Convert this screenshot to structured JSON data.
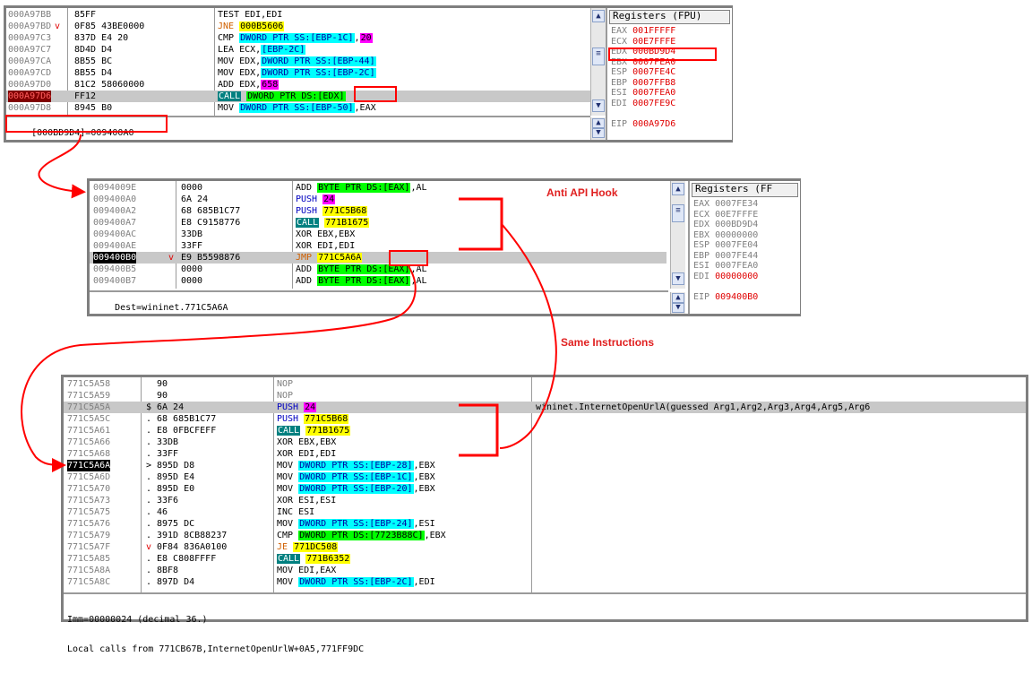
{
  "panel1": {
    "rows": [
      {
        "addr": "000A97BB",
        "mark": "",
        "bytes": "85FF",
        "instr": [
          {
            "t": "TEST EDI,EDI"
          }
        ]
      },
      {
        "addr": "000A97BD",
        "mark": "v",
        "bytes": "0F85 43BE0000",
        "instr": [
          {
            "t": "JNE",
            "c": "kw-orange"
          },
          {
            "t": " "
          },
          {
            "t": "000B5606",
            "h": "yellow"
          }
        ]
      },
      {
        "addr": "000A97C3",
        "mark": "",
        "bytes": "837D E4 20",
        "instr": [
          {
            "t": "CMP "
          },
          {
            "t": "DWORD PTR SS:[EBP-1C]",
            "h": "cyan"
          },
          {
            "t": ","
          },
          {
            "t": "20",
            "h": "magenta"
          }
        ]
      },
      {
        "addr": "000A97C7",
        "mark": "",
        "bytes": "8D4D D4",
        "instr": [
          {
            "t": "LEA ECX,"
          },
          {
            "t": "[EBP-2C]",
            "h": "cyan"
          }
        ]
      },
      {
        "addr": "000A97CA",
        "mark": "",
        "bytes": "8B55 BC",
        "instr": [
          {
            "t": "MOV EDX,"
          },
          {
            "t": "DWORD PTR SS:[EBP-44]",
            "h": "cyan"
          }
        ]
      },
      {
        "addr": "000A97CD",
        "mark": "",
        "bytes": "8B55 D4",
        "instr": [
          {
            "t": "MOV EDX,"
          },
          {
            "t": "DWORD PTR SS:[EBP-2C]",
            "h": "cyan"
          }
        ]
      },
      {
        "addr": "000A97D0",
        "mark": "",
        "bytes": "81C2 58060000",
        "instr": [
          {
            "t": "ADD EDX,"
          },
          {
            "t": "658",
            "h": "magenta"
          }
        ]
      },
      {
        "addr": "000A97D6",
        "mark": "",
        "bytes": "FF12",
        "sel": true,
        "addrStyle": "bp",
        "instr": [
          {
            "t": "CALL",
            "h": "teal"
          },
          {
            "t": " "
          },
          {
            "t": "DWORD PTR DS:[EDX]",
            "h": "green"
          }
        ]
      },
      {
        "addr": "000A97D8",
        "mark": "",
        "bytes": "8945 B0",
        "instr": [
          {
            "t": "MOV "
          },
          {
            "t": "DWORD PTR SS:[EBP-50]",
            "h": "cyan"
          },
          {
            "t": ",EAX"
          }
        ]
      }
    ],
    "info": "[000BD9D4]=009400A0",
    "regs_title": "Registers (FPU)",
    "regs": [
      {
        "n": "EAX",
        "v": "001FFFFF",
        "c": "red"
      },
      {
        "n": "ECX",
        "v": "00E7FFFE",
        "c": "red"
      },
      {
        "n": "EDX",
        "v": "000BD9D4",
        "c": "red"
      },
      {
        "n": "EBX",
        "v": "0007FEA0",
        "c": "red"
      },
      {
        "n": "ESP",
        "v": "0007FE4C",
        "c": "red"
      },
      {
        "n": "EBP",
        "v": "0007FFB8",
        "c": "red"
      },
      {
        "n": "ESI",
        "v": "0007FEA0",
        "c": "red"
      },
      {
        "n": "EDI",
        "v": "0007FE9C",
        "c": "red"
      },
      {
        "n": "",
        "v": "",
        "c": "red"
      },
      {
        "n": "EIP",
        "v": "000A97D6",
        "c": "red"
      }
    ]
  },
  "panel2": {
    "rows": [
      {
        "addr": "0094009E",
        "mark": "",
        "bytes": "0000",
        "instr": [
          {
            "t": "ADD "
          },
          {
            "t": "BYTE PTR DS:[EAX]",
            "h": "green"
          },
          {
            "t": ",AL"
          }
        ]
      },
      {
        "addr": "009400A0",
        "mark": "",
        "bytes": "6A 24",
        "instr": [
          {
            "t": "PUSH",
            "c": "kw-blue"
          },
          {
            "t": " "
          },
          {
            "t": "24",
            "h": "magenta"
          }
        ]
      },
      {
        "addr": "009400A2",
        "mark": "",
        "bytes": "68 685B1C77",
        "instr": [
          {
            "t": "PUSH",
            "c": "kw-blue"
          },
          {
            "t": " "
          },
          {
            "t": "771C5B68",
            "h": "yellow"
          }
        ]
      },
      {
        "addr": "009400A7",
        "mark": "",
        "bytes": "E8 C9158776",
        "instr": [
          {
            "t": "CALL",
            "h": "teal"
          },
          {
            "t": " "
          },
          {
            "t": "771B1675",
            "h": "yellow"
          }
        ]
      },
      {
        "addr": "009400AC",
        "mark": "",
        "bytes": "33DB",
        "instr": [
          {
            "t": "XOR EBX,EBX"
          }
        ]
      },
      {
        "addr": "009400AE",
        "mark": "",
        "bytes": "33FF",
        "instr": [
          {
            "t": "XOR EDI,EDI"
          }
        ]
      },
      {
        "addr": "009400B0",
        "mark": "v",
        "bytes": "E9 B5598876",
        "sel": true,
        "addrStyle": "cur",
        "instr": [
          {
            "t": "JMP",
            "c": "kw-orange"
          },
          {
            "t": " "
          },
          {
            "t": "771C5A6A",
            "h": "yellow"
          }
        ]
      },
      {
        "addr": "009400B5",
        "mark": "",
        "bytes": "0000",
        "instr": [
          {
            "t": "ADD "
          },
          {
            "t": "BYTE PTR DS:[EAX]",
            "h": "green"
          },
          {
            "t": ",AL"
          }
        ]
      },
      {
        "addr": "009400B7",
        "mark": "",
        "bytes": "0000",
        "instr": [
          {
            "t": "ADD "
          },
          {
            "t": "BYTE PTR DS:[EAX]",
            "h": "green"
          },
          {
            "t": ",AL"
          }
        ]
      }
    ],
    "info": "Dest=wininet.771C5A6A",
    "regs_title": "Registers (FF",
    "regs": [
      {
        "n": "EAX",
        "v": "0007FE34",
        "c": "gray"
      },
      {
        "n": "ECX",
        "v": "00E7FFFE",
        "c": "gray"
      },
      {
        "n": "EDX",
        "v": "000BD9D4",
        "c": "gray"
      },
      {
        "n": "EBX",
        "v": "00000000",
        "c": "gray"
      },
      {
        "n": "ESP",
        "v": "0007FE04",
        "c": "gray"
      },
      {
        "n": "EBP",
        "v": "0007FE44",
        "c": "gray"
      },
      {
        "n": "ESI",
        "v": "0007FEA0",
        "c": "gray"
      },
      {
        "n": "EDI",
        "v": "00000000",
        "c": "red"
      },
      {
        "n": "",
        "v": "",
        "c": "gray"
      },
      {
        "n": "EIP",
        "v": "009400B0",
        "c": "red"
      }
    ]
  },
  "panel3": {
    "rows": [
      {
        "addr": "771C5A58",
        "mark": "",
        "bytes": "90",
        "instr": [
          {
            "t": "NOP",
            "c": "gray"
          }
        ]
      },
      {
        "addr": "771C5A59",
        "mark": "",
        "bytes": "90",
        "instr": [
          {
            "t": "NOP",
            "c": "gray"
          }
        ]
      },
      {
        "addr": "771C5A5A",
        "mark": "$",
        "bytes": "6A 24",
        "sel": true,
        "instr": [
          {
            "t": "PUSH",
            "c": "kw-blue"
          },
          {
            "t": " "
          },
          {
            "t": "24",
            "h": "magenta"
          }
        ],
        "comment": "wininet.InternetOpenUrlA(guessed Arg1,Arg2,Arg3,Arg4,Arg5,Arg6"
      },
      {
        "addr": "771C5A5C",
        "mark": ".",
        "bytes": "68 685B1C77",
        "instr": [
          {
            "t": "PUSH",
            "c": "kw-blue"
          },
          {
            "t": " "
          },
          {
            "t": "771C5B68",
            "h": "yellow"
          }
        ]
      },
      {
        "addr": "771C5A61",
        "mark": ".",
        "bytes": "E8 0FBCFEFF",
        "instr": [
          {
            "t": "CALL",
            "h": "teal"
          },
          {
            "t": " "
          },
          {
            "t": "771B1675",
            "h": "yellow"
          }
        ]
      },
      {
        "addr": "771C5A66",
        "mark": ".",
        "bytes": "33DB",
        "instr": [
          {
            "t": "XOR EBX,EBX"
          }
        ]
      },
      {
        "addr": "771C5A68",
        "mark": ".",
        "bytes": "33FF",
        "instr": [
          {
            "t": "XOR EDI,EDI"
          }
        ]
      },
      {
        "addr": "771C5A6A",
        "mark": ">",
        "bytes": "895D D8",
        "addrStyle": "cur",
        "instr": [
          {
            "t": "MOV "
          },
          {
            "t": "DWORD PTR SS:[EBP-28]",
            "h": "cyan"
          },
          {
            "t": ",EBX"
          }
        ]
      },
      {
        "addr": "771C5A6D",
        "mark": ".",
        "bytes": "895D E4",
        "instr": [
          {
            "t": "MOV "
          },
          {
            "t": "DWORD PTR SS:[EBP-1C]",
            "h": "cyan"
          },
          {
            "t": ",EBX"
          }
        ]
      },
      {
        "addr": "771C5A70",
        "mark": ".",
        "bytes": "895D E0",
        "instr": [
          {
            "t": "MOV "
          },
          {
            "t": "DWORD PTR SS:[EBP-20]",
            "h": "cyan"
          },
          {
            "t": ",EBX"
          }
        ]
      },
      {
        "addr": "771C5A73",
        "mark": ".",
        "bytes": "33F6",
        "instr": [
          {
            "t": "XOR ESI,ESI"
          }
        ]
      },
      {
        "addr": "771C5A75",
        "mark": ".",
        "bytes": "46",
        "instr": [
          {
            "t": "INC ESI"
          }
        ]
      },
      {
        "addr": "771C5A76",
        "mark": ".",
        "bytes": "8975 DC",
        "instr": [
          {
            "t": "MOV "
          },
          {
            "t": "DWORD PTR SS:[EBP-24]",
            "h": "cyan"
          },
          {
            "t": ",ESI"
          }
        ]
      },
      {
        "addr": "771C5A79",
        "mark": ".",
        "bytes": "391D 8CB88237",
        "instr": [
          {
            "t": "CMP "
          },
          {
            "t": "DWORD PTR DS:[7723B88C]",
            "h": "green"
          },
          {
            "t": ",EBX"
          }
        ]
      },
      {
        "addr": "771C5A7F",
        "mark": "v",
        "bytes": "0F84 836A0100",
        "instr": [
          {
            "t": "JE",
            "c": "kw-orange"
          },
          {
            "t": " "
          },
          {
            "t": "771DC508",
            "h": "yellow"
          }
        ]
      },
      {
        "addr": "771C5A85",
        "mark": ".",
        "bytes": "E8 C808FFFF",
        "instr": [
          {
            "t": "CALL",
            "h": "teal"
          },
          {
            "t": " "
          },
          {
            "t": "771B6352",
            "h": "yellow"
          }
        ]
      },
      {
        "addr": "771C5A8A",
        "mark": ".",
        "bytes": "8BF8",
        "instr": [
          {
            "t": "MOV EDI,EAX"
          }
        ]
      },
      {
        "addr": "771C5A8C",
        "mark": ".",
        "bytes": "897D D4",
        "instr": [
          {
            "t": "MOV "
          },
          {
            "t": "DWORD PTR SS:[EBP-2C]",
            "h": "cyan"
          },
          {
            "t": ",EDI"
          }
        ]
      }
    ],
    "info1": "Imm=00000024 (decimal 36.)",
    "info2": "Local calls from 771CB67B,InternetOpenUrlW+0A5,771FF9DC"
  },
  "annotations": {
    "anti_hook": "Anti API Hook",
    "same_instr": "Same Instructions"
  },
  "colors": {
    "annotation_red": "#ff0000",
    "highlight_cyan": "#00ffff",
    "highlight_green": "#00ff00",
    "highlight_yellow": "#ffff00",
    "highlight_magenta": "#ff00ff"
  }
}
